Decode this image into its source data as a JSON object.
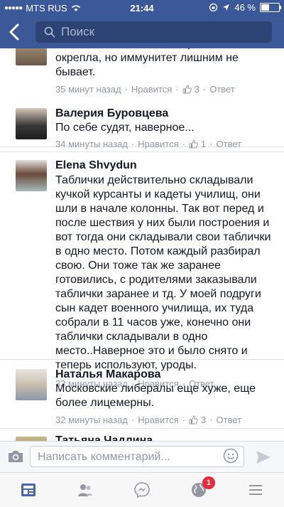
{
  "status_bar": {
    "carrier": "MTS RUS",
    "time": "21:44",
    "battery": "46 %",
    "battery_fraction": 0.46
  },
  "nav": {
    "search_placeholder": "Поиск"
  },
  "comments": [
    {
      "name": "",
      "text": "Наташа, оставайтесь. Страна конечно окрепла, но иммунитет лишним не бывает.",
      "time": "35 минут назад",
      "like_label": "Нравится",
      "likes": "3",
      "reply_label": "Ответ"
    },
    {
      "name": "Валерия Буровцева",
      "text": "По себе судят, наверное...",
      "time": "34 минуты назад",
      "like_label": "Нравится",
      "likes": "1",
      "reply_label": "Ответ"
    },
    {
      "name": "Elena Shvydun",
      "text": "Таблички действительно складывали кучкой курсанты и кадеты училищ, они шли в начале колонны. Так вот перед и после шествия у них были построения и вот тогда они складывали свои таблички в одно место. Потом каждый разбирал свою. Они тоже так же заранее готовились, с родителями заказывали таблички заранее и тд. У моей подруги сын кадет военного училища, их туда собрали в 11 часов уже, конечно они таблички складывали в одно место..Наверное это и было снято и теперь используют, уроды.",
      "time": "33 минуты назад",
      "like_label": "Нравится",
      "likes": "",
      "reply_label": "Ответ"
    },
    {
      "name": "Наталья Макарова",
      "text": "Московские либералы еще хуже, еще более лицемерны.",
      "time": "32 минуты назад",
      "like_label": "Нравится",
      "likes": "3",
      "reply_label": "Ответ"
    },
    {
      "name": "Татьяна Чадлина",
      "text": "",
      "time": "",
      "like_label": "",
      "likes": "",
      "reply_label": ""
    }
  ],
  "input_bar": {
    "placeholder": "Написать комментарий..."
  },
  "tab_bar": {
    "notifications_badge": "1",
    "tabs": [
      "news-feed-icon",
      "friends-icon",
      "messenger-icon",
      "globe-icon",
      "menu-icon"
    ]
  },
  "colors": {
    "brand": "#3b5998",
    "meta_text": "#9197a3",
    "badge": "#e9293a"
  }
}
